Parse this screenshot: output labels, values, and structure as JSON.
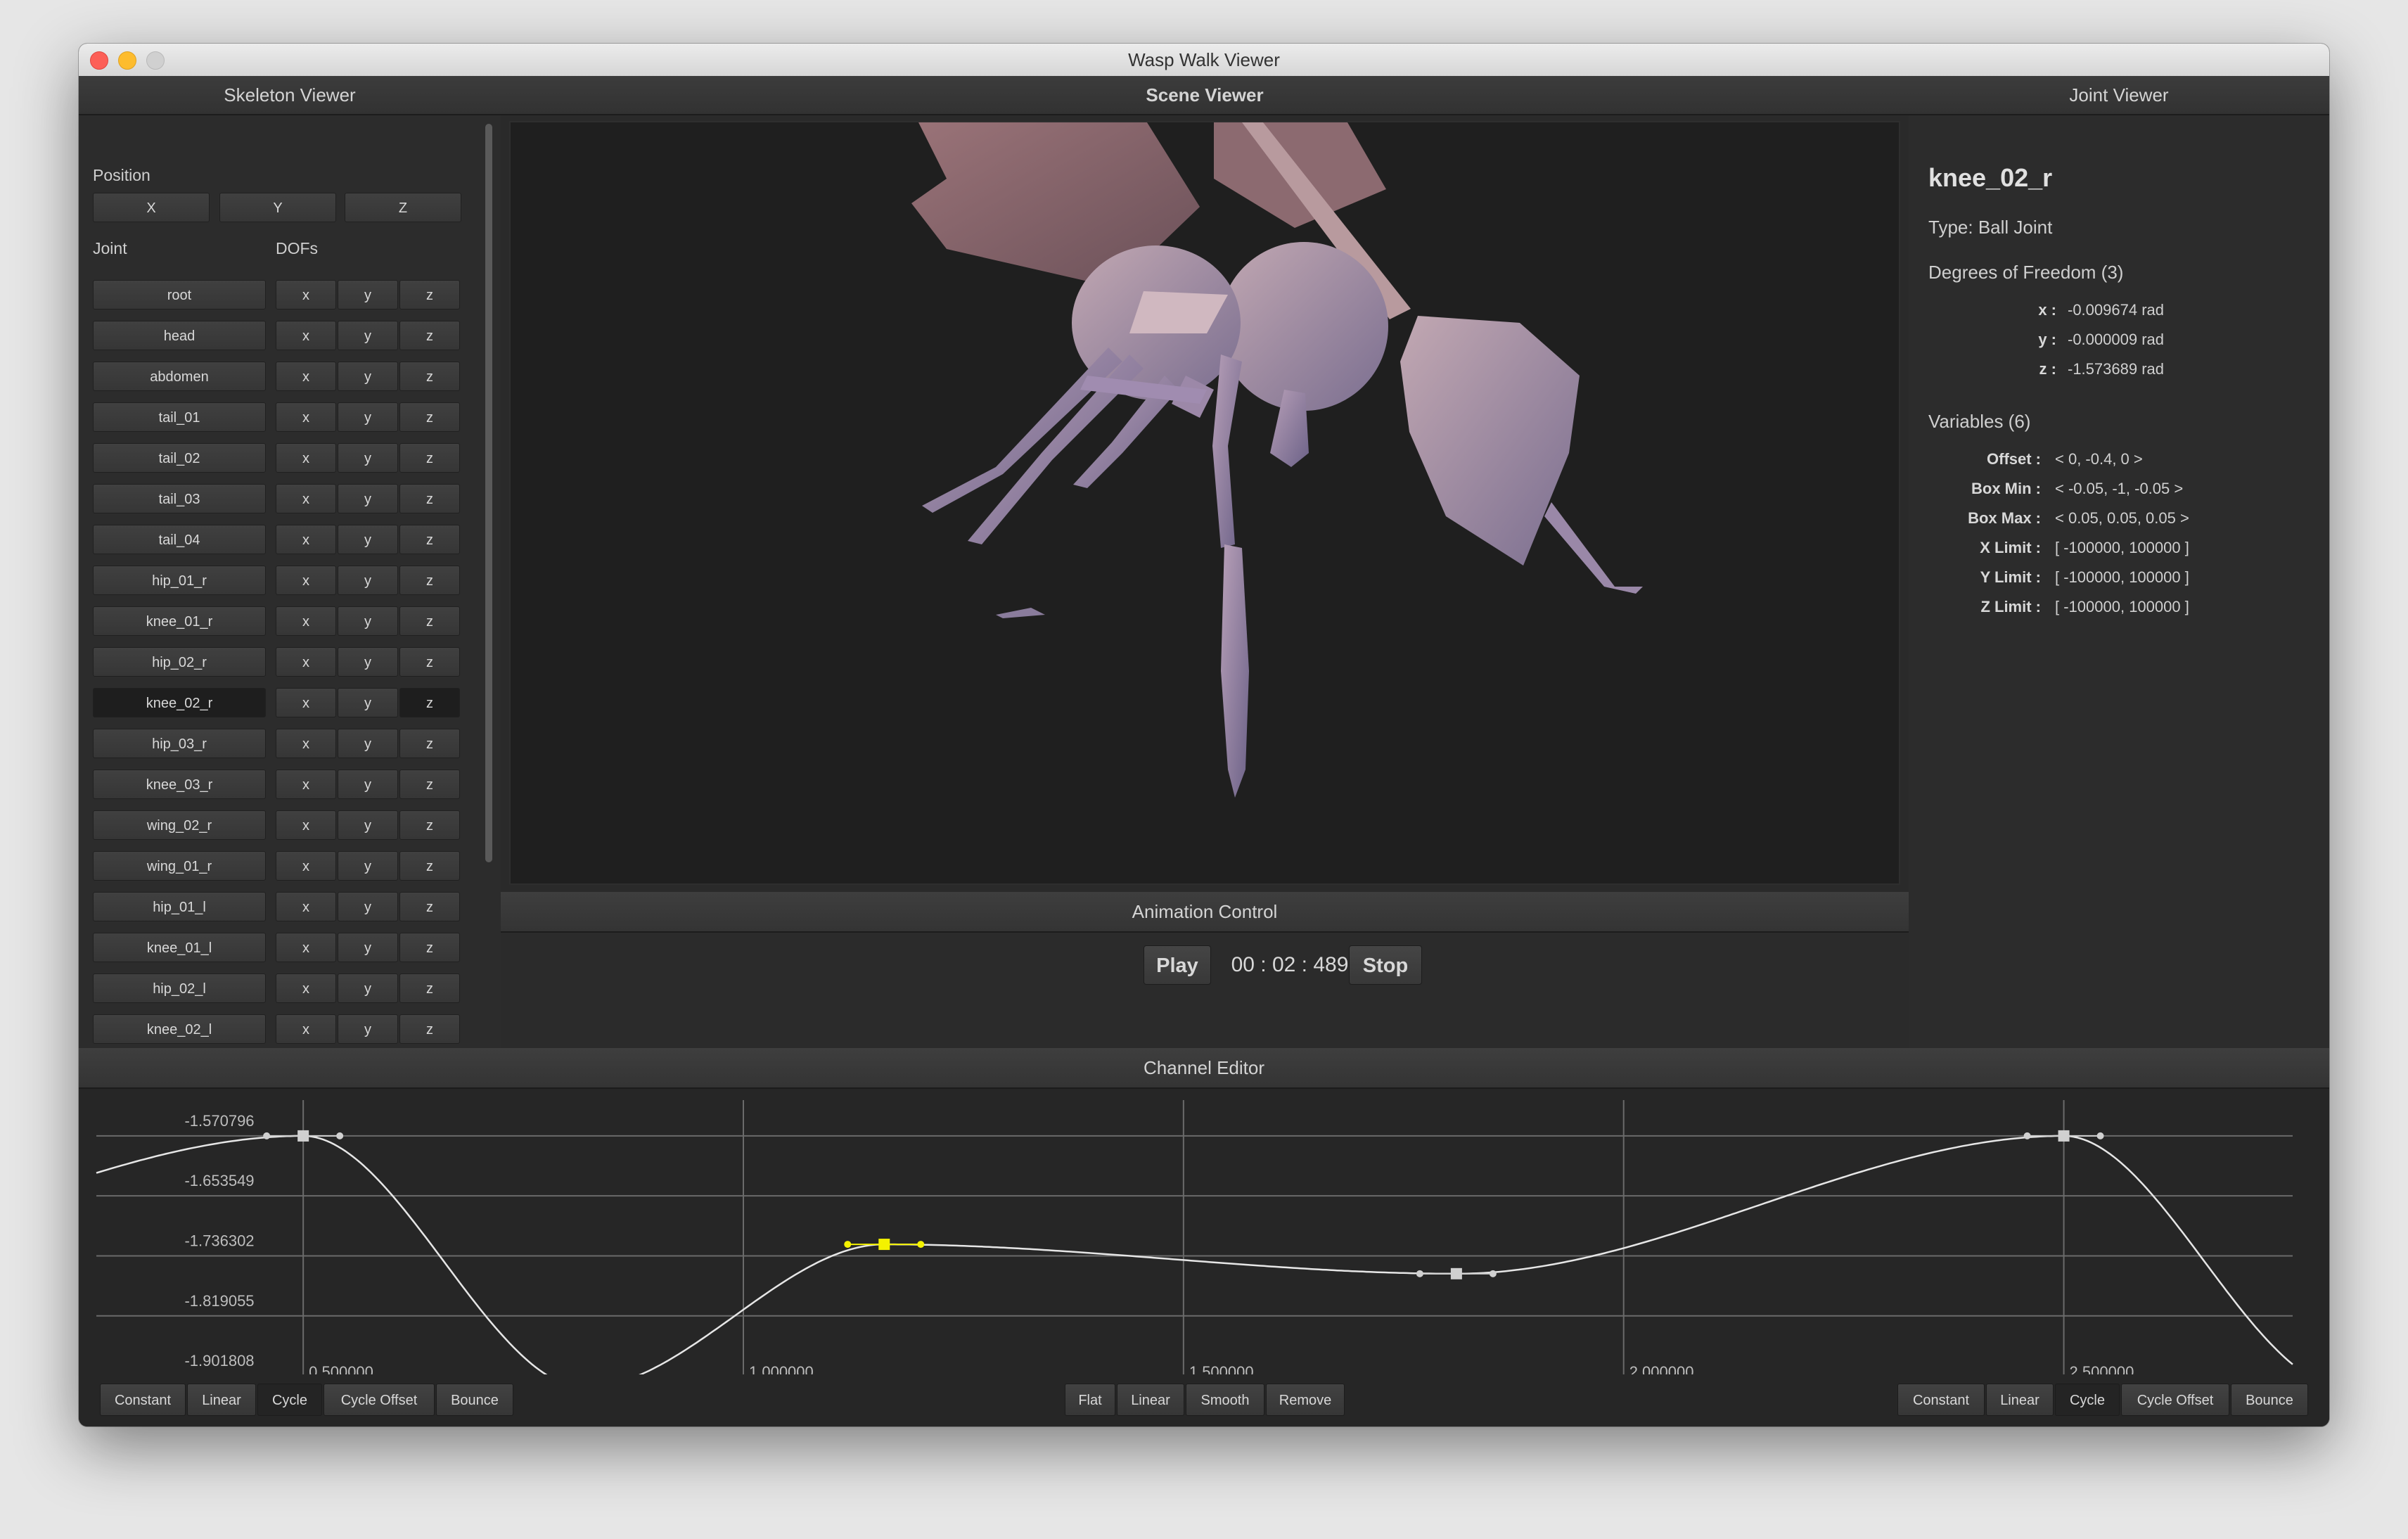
{
  "window": {
    "title": "Wasp Walk Viewer"
  },
  "skeleton_viewer": {
    "header": "Skeleton Viewer",
    "position_label": "Position",
    "position_buttons": [
      "X",
      "Y",
      "Z"
    ],
    "joint_label": "Joint",
    "dofs_label": "DOFs",
    "joints": [
      {
        "name": "root",
        "dofs": [
          "x",
          "y",
          "z"
        ]
      },
      {
        "name": "head",
        "dofs": [
          "x",
          "y",
          "z"
        ]
      },
      {
        "name": "abdomen",
        "dofs": [
          "x",
          "y",
          "z"
        ]
      },
      {
        "name": "tail_01",
        "dofs": [
          "x",
          "y",
          "z"
        ]
      },
      {
        "name": "tail_02",
        "dofs": [
          "x",
          "y",
          "z"
        ]
      },
      {
        "name": "tail_03",
        "dofs": [
          "x",
          "y",
          "z"
        ]
      },
      {
        "name": "tail_04",
        "dofs": [
          "x",
          "y",
          "z"
        ]
      },
      {
        "name": "hip_01_r",
        "dofs": [
          "x",
          "y",
          "z"
        ]
      },
      {
        "name": "knee_01_r",
        "dofs": [
          "x",
          "y",
          "z"
        ]
      },
      {
        "name": "hip_02_r",
        "dofs": [
          "x",
          "y",
          "z"
        ]
      },
      {
        "name": "knee_02_r",
        "dofs": [
          "x",
          "y",
          "z"
        ],
        "selected": true,
        "selected_dof": "z"
      },
      {
        "name": "hip_03_r",
        "dofs": [
          "x",
          "y",
          "z"
        ]
      },
      {
        "name": "knee_03_r",
        "dofs": [
          "x",
          "y",
          "z"
        ]
      },
      {
        "name": "wing_02_r",
        "dofs": [
          "x",
          "y",
          "z"
        ]
      },
      {
        "name": "wing_01_r",
        "dofs": [
          "x",
          "y",
          "z"
        ]
      },
      {
        "name": "hip_01_l",
        "dofs": [
          "x",
          "y",
          "z"
        ]
      },
      {
        "name": "knee_01_l",
        "dofs": [
          "x",
          "y",
          "z"
        ]
      },
      {
        "name": "hip_02_l",
        "dofs": [
          "x",
          "y",
          "z"
        ]
      },
      {
        "name": "knee_02_l",
        "dofs": [
          "x",
          "y",
          "z"
        ]
      }
    ]
  },
  "scene_viewer": {
    "header": "Scene Viewer"
  },
  "animation_control": {
    "header": "Animation Control",
    "play_label": "Play",
    "time": "00 : 02 : 489",
    "stop_label": "Stop"
  },
  "joint_viewer": {
    "header": "Joint Viewer",
    "joint_name": "knee_02_r",
    "type": "Type: Ball Joint",
    "dof_heading": "Degrees of Freedom (3)",
    "dofs": [
      {
        "key": "x :",
        "value": "-0.009674 rad"
      },
      {
        "key": "y :",
        "value": "-0.000009 rad"
      },
      {
        "key": "z :",
        "value": "-1.573689 rad"
      }
    ],
    "var_heading": "Variables (6)",
    "variables": [
      {
        "key": "Offset :",
        "value": "< 0, -0.4, 0 >"
      },
      {
        "key": "Box Min :",
        "value": "< -0.05, -1, -0.05 >"
      },
      {
        "key": "Box Max :",
        "value": "< 0.05, 0.05, 0.05 >"
      },
      {
        "key": "X Limit :",
        "value": "[ -100000, 100000 ]"
      },
      {
        "key": "Y Limit :",
        "value": "[ -100000, 100000 ]"
      },
      {
        "key": "Z Limit :",
        "value": "[ -100000, 100000 ]"
      }
    ]
  },
  "channel_editor": {
    "header": "Channel Editor",
    "y_ticks": [
      "-1.570796",
      "-1.653549",
      "-1.736302",
      "-1.819055",
      "-1.901808"
    ],
    "x_ticks": [
      "0.500000",
      "1.000000",
      "1.500000",
      "2.000000",
      "2.500000"
    ],
    "left_extrap": [
      "Constant",
      "Linear",
      "Cycle",
      "Cycle Offset",
      "Bounce"
    ],
    "left_selected": "Cycle",
    "tangent_buttons": [
      "Flat",
      "Linear",
      "Smooth",
      "Remove"
    ],
    "right_extrap": [
      "Constant",
      "Linear",
      "Cycle",
      "Cycle Offset",
      "Bounce"
    ],
    "right_selected": "Cycle",
    "curve_color": "#e6e6e6",
    "selected_color": "#f4f200",
    "keyframes": [
      {
        "t": 0.5,
        "v": -1.5708
      },
      {
        "t": 0.82,
        "v": -1.918
      },
      {
        "t": 1.16,
        "v": -1.7204
      },
      {
        "t": 1.81,
        "v": -1.7609
      },
      {
        "t": 2.5,
        "v": -1.5708
      }
    ],
    "selected_key_index": 2
  }
}
